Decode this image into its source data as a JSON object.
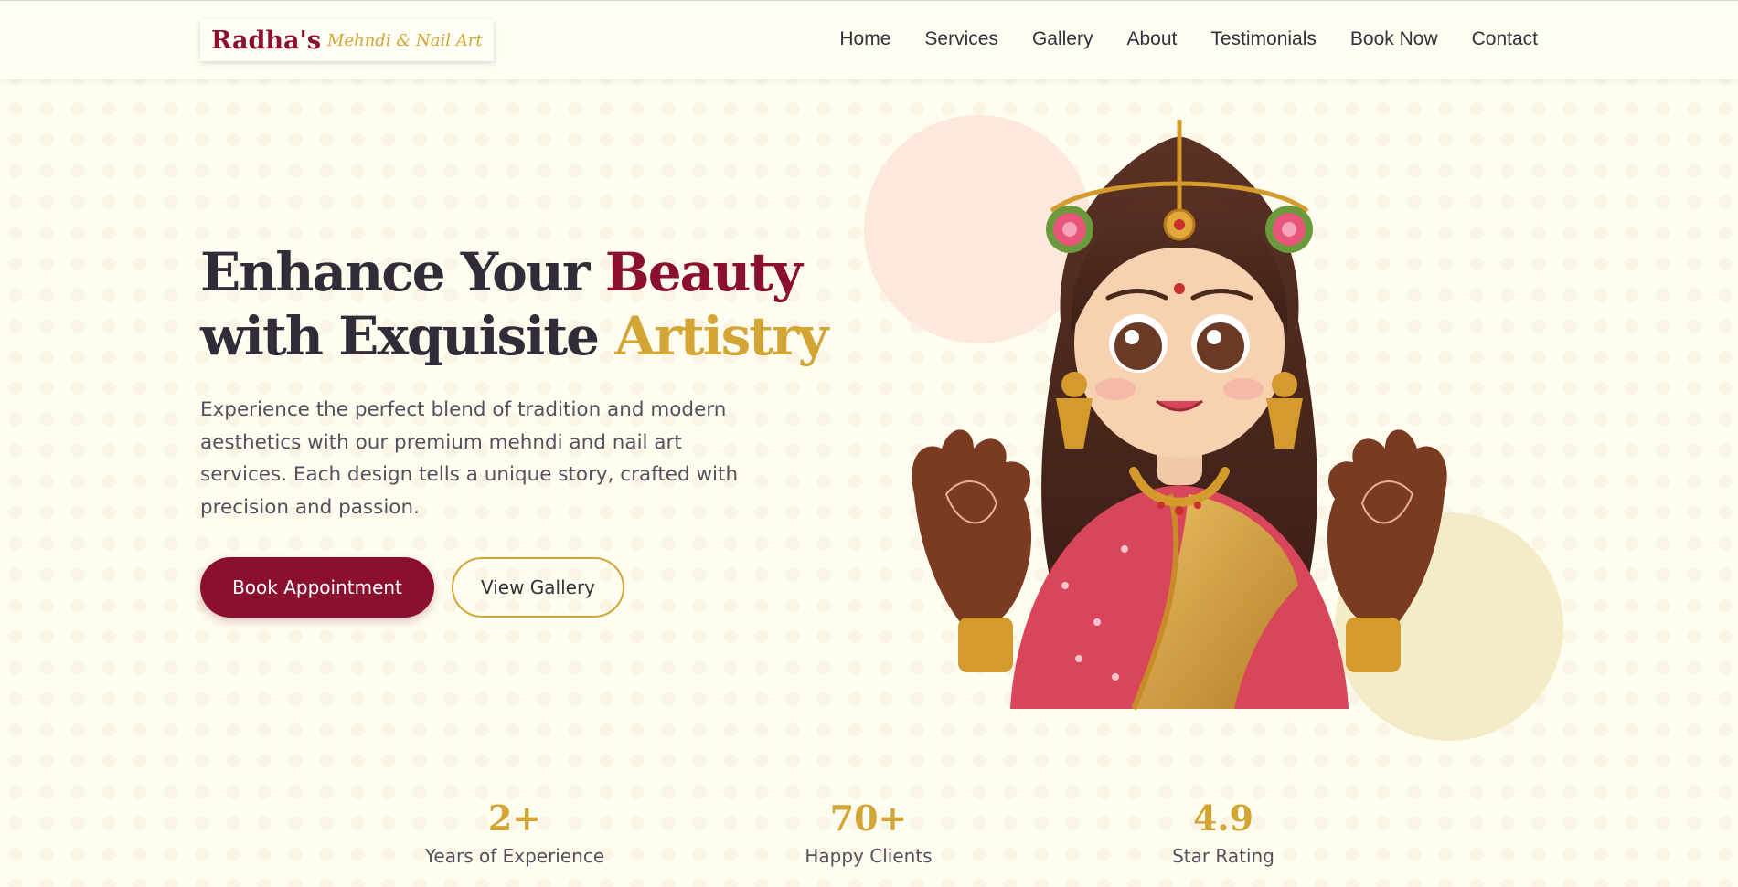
{
  "brand": {
    "name": "Radha's",
    "tagline": "Mehndi & Nail Art",
    "primary_color": "#8b1030",
    "gold_color": "#d2a535",
    "background_color": "#fffdf0"
  },
  "nav": {
    "items": [
      {
        "label": "Home"
      },
      {
        "label": "Services"
      },
      {
        "label": "Gallery"
      },
      {
        "label": "About"
      },
      {
        "label": "Testimonials"
      },
      {
        "label": "Book Now"
      },
      {
        "label": "Contact"
      }
    ]
  },
  "hero": {
    "headline_part1": "Enhance Your ",
    "headline_accent1": "Beauty",
    "headline_part2": "with Exquisite ",
    "headline_accent2": "Artistry",
    "description": "Experience the perfect blend of tradition and modern aesthetics with our premium mehndi and nail art services. Each design tells a unique story, crafted with precision and passion.",
    "primary_button": "Book Appointment",
    "secondary_button": "View Gallery",
    "illustration": "bride-with-mehndi-hands-illustration"
  },
  "stats": [
    {
      "value": "2+",
      "label": "Years of Experience"
    },
    {
      "value": "70+",
      "label": "Happy Clients"
    },
    {
      "value": "4.9",
      "label": "Star Rating"
    }
  ]
}
